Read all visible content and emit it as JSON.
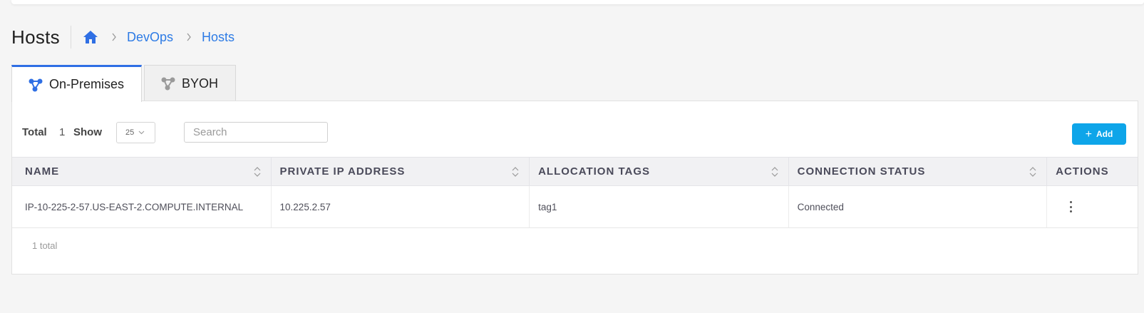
{
  "header": {
    "title": "Hosts",
    "breadcrumb": [
      "DevOps",
      "Hosts"
    ]
  },
  "tabs": [
    {
      "label": "On-Premises",
      "active": true
    },
    {
      "label": "BYOH",
      "active": false
    }
  ],
  "toolbar": {
    "total_label": "Total",
    "total_value": "1",
    "show_label": "Show",
    "page_size": "25",
    "search_placeholder": "Search",
    "add_label": "Add"
  },
  "table": {
    "columns": [
      "NAME",
      "PRIVATE IP ADDRESS",
      "ALLOCATION TAGS",
      "CONNECTION STATUS",
      "ACTIONS"
    ],
    "rows": [
      {
        "name": "IP-10-225-2-57.US-EAST-2.COMPUTE.INTERNAL",
        "ip": "10.225.2.57",
        "tags": "tag1",
        "status": "Connected"
      }
    ],
    "footer_total": "1 total"
  },
  "colors": {
    "accent": "#2f6fe4",
    "link": "#2d7be5",
    "add_button": "#0ea5e9"
  },
  "icons": {
    "home": "home-icon",
    "tab_on_prem": "nodes-icon",
    "tab_byoh": "nodes-icon",
    "breadcrumb_separator": "chevron-right-icon",
    "sort": "sort-icon",
    "actions": "kebab-menu-icon"
  }
}
